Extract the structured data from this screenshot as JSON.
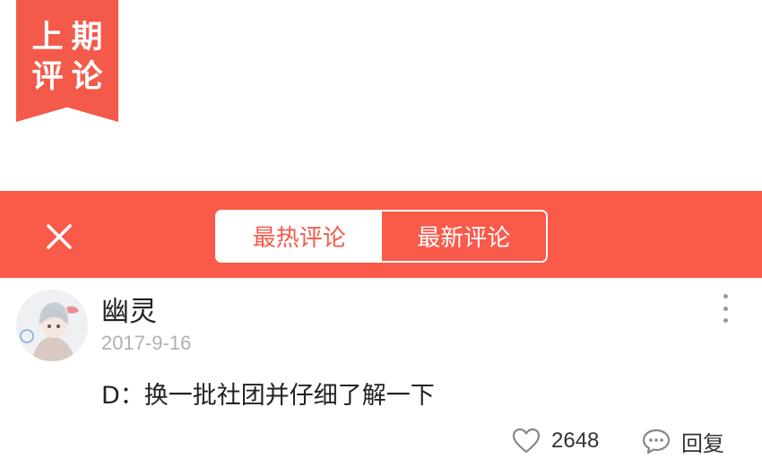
{
  "ribbon": {
    "line1": "上期",
    "line2": "评论"
  },
  "tabs": [
    {
      "label": "最热评论",
      "active": true
    },
    {
      "label": "最新评论",
      "active": false
    }
  ],
  "comment": {
    "username": "幽灵",
    "date": "2017-9-16",
    "content": "D：换一批社团并仔细了解一下",
    "likes": "2648",
    "reply_label": "回复"
  },
  "colors": {
    "accent": "#f95a4a",
    "text": "#222222",
    "muted": "#b0b0b0"
  },
  "icons": {
    "close": "close-icon",
    "more": "more-vertical-icon",
    "like": "heart-outline-icon",
    "reply": "comment-bubble-icon"
  }
}
